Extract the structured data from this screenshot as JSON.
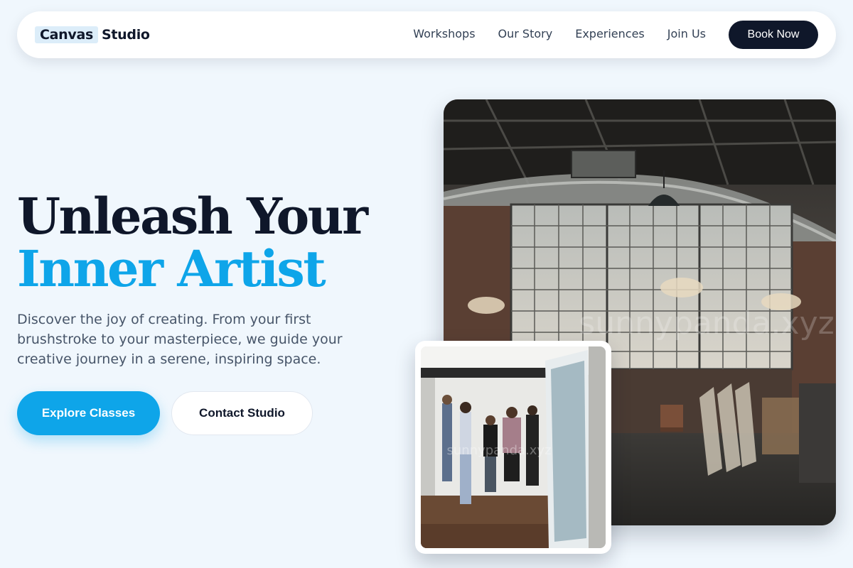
{
  "nav": {
    "logo_mark": "Canvas",
    "logo_text": "Studio",
    "links": [
      "Workshops",
      "Our Story",
      "Experiences",
      "Join Us"
    ],
    "cta": "Book Now"
  },
  "hero": {
    "title_line1": "Unleash Your",
    "title_line2": "Inner Artist",
    "description": "Discover the joy of creating. From your first brushstroke to your masterpiece, we guide your creative journey in a serene, inspiring space.",
    "primary_button": "Explore Classes",
    "secondary_button": "Contact Studio"
  },
  "images": {
    "watermark_main": "sunnypanda.xyz",
    "watermark_inset": "sunnypanda.xyz"
  },
  "colors": {
    "background": "#f0f7fd",
    "navy": "#0f172a",
    "accent": "#0ea5e9",
    "logo_highlight": "#dcedf9"
  }
}
